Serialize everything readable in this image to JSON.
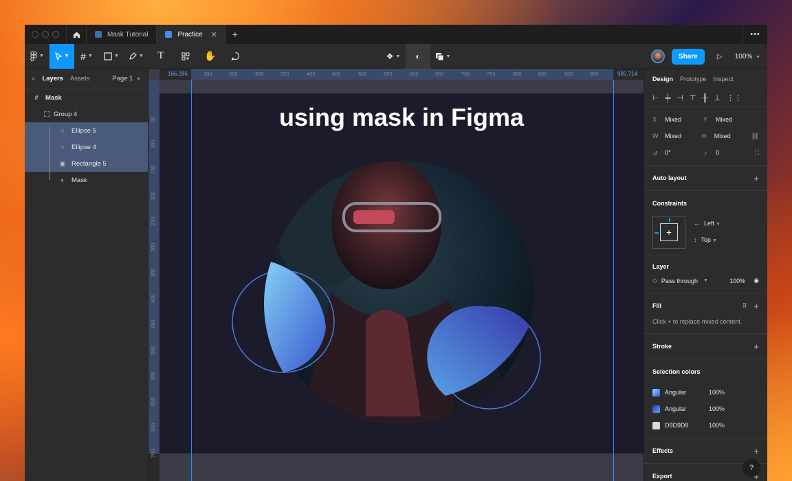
{
  "titlebar": {
    "tabs": [
      {
        "label": "Mask Tutorial",
        "active": false
      },
      {
        "label": "Practice",
        "active": true
      }
    ],
    "add_tab": "+",
    "more": "•••"
  },
  "toolbar": {
    "share_label": "Share",
    "zoom": "100%"
  },
  "left_panel": {
    "tabs": [
      "Layers",
      "Assets"
    ],
    "page": "Page 1",
    "layers": [
      {
        "label": "Mask",
        "icon": "frame-icon"
      },
      {
        "label": "Group 4",
        "icon": "group-icon"
      },
      {
        "label": "Ellipse 5",
        "icon": "ellipse-icon"
      },
      {
        "label": "Ellipse 4",
        "icon": "ellipse-icon"
      },
      {
        "label": "Rectangle 5",
        "icon": "image-icon"
      },
      {
        "label": "Mask",
        "icon": "mask-icon"
      }
    ]
  },
  "canvas": {
    "title": "using mask in Figma",
    "ruler_left_edge": "166.286",
    "ruler_right_edge": "985.714",
    "ruler_x": [
      "300",
      "250",
      "300",
      "350",
      "400",
      "450",
      "500",
      "550",
      "600",
      "650",
      "700",
      "750",
      "800",
      "850",
      "900",
      "950"
    ],
    "ruler_y": [
      "50",
      "100",
      "150",
      "200",
      "250",
      "300",
      "350",
      "400",
      "450",
      "500",
      "550",
      "600",
      "650",
      "700"
    ]
  },
  "right_panel": {
    "tabs": [
      "Design",
      "Prototype",
      "Inspect"
    ],
    "x_label": "X",
    "x_value": "Mixed",
    "y_label": "Y",
    "y_value": "Mixed",
    "w_label": "W",
    "w_value": "Mixed",
    "h_label": "H",
    "h_value": "Mixed",
    "rotation": "0°",
    "radius": "0",
    "auto_layout": "Auto layout",
    "constraints": "Constraints",
    "constraint_h": "Left",
    "constraint_v": "Top",
    "layer": "Layer",
    "blend_mode": "Pass through",
    "opacity": "100%",
    "fill": "Fill",
    "fill_note": "Click + to replace mixed content.",
    "stroke": "Stroke",
    "selection_colors": "Selection colors",
    "colors": [
      {
        "name": "Angular",
        "opacity": "100%"
      },
      {
        "name": "Angular",
        "opacity": "100%"
      },
      {
        "name": "D9D9D9",
        "opacity": "100%"
      }
    ],
    "effects": "Effects",
    "export": "Export",
    "help": "?"
  }
}
